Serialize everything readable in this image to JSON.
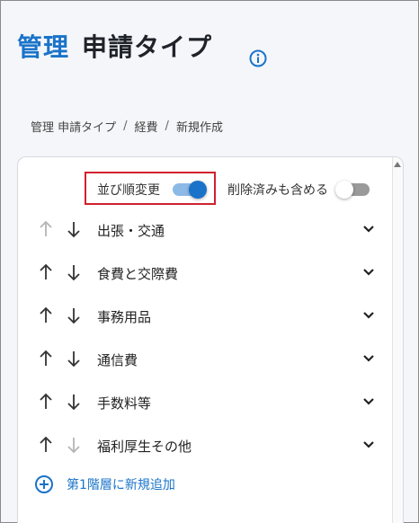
{
  "header": {
    "title_accent": "管理",
    "title_main": "申請タイプ"
  },
  "breadcrumb": {
    "items": [
      "管理 申請タイプ",
      "経費",
      "新規作成"
    ],
    "separator": "/"
  },
  "controls": {
    "sort_label": "並び順変更",
    "sort_toggle": "on",
    "include_deleted_label": "削除済みも含める",
    "include_deleted_toggle": "off"
  },
  "rows": [
    {
      "label": "出張・交通"
    },
    {
      "label": "食費と交際費"
    },
    {
      "label": "事務用品"
    },
    {
      "label": "通信費"
    },
    {
      "label": "手数料等"
    },
    {
      "label": "福利厚生その他"
    }
  ],
  "add": {
    "label": "第1階層に新規追加"
  },
  "colors": {
    "accent": "#1a73c9",
    "highlight_box": "#d2202f",
    "disabled_arrow": "#b5b5b5",
    "active_arrow": "#333333"
  }
}
